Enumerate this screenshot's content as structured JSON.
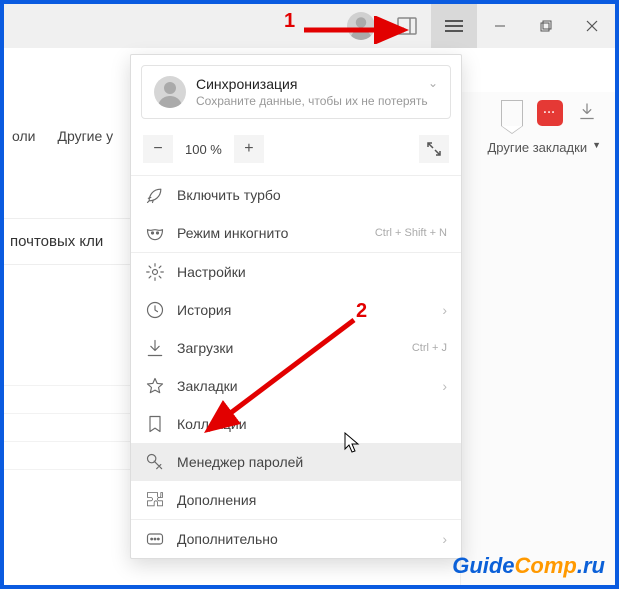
{
  "titlebar": {
    "hamburger_name": "menu-button"
  },
  "toolbar": {
    "other_bookmarks": "Другие закладки",
    "password_badge": "•••"
  },
  "page": {
    "snippet1a": "оли",
    "snippet1b": "Другие у",
    "snippet2": "почтовых кли"
  },
  "sync": {
    "title": "Синхронизация",
    "subtitle": "Сохраните данные, чтобы их не потерять"
  },
  "zoom": {
    "minus": "−",
    "value": "100 %",
    "plus": "+"
  },
  "menu": {
    "turbo": "Включить турбо",
    "incognito": "Режим инкогнито",
    "incognito_shortcut": "Ctrl + Shift + N",
    "settings": "Настройки",
    "history": "История",
    "downloads": "Загрузки",
    "downloads_shortcut": "Ctrl + J",
    "bookmarks": "Закладки",
    "collections": "Коллекции",
    "passwords": "Менеджер паролей",
    "addons": "Дополнения",
    "more": "Дополнительно"
  },
  "annotations": {
    "num1": "1",
    "num2": "2"
  },
  "watermark": {
    "part1": "Guide",
    "part2": "Comp",
    "part3": ".ru"
  }
}
